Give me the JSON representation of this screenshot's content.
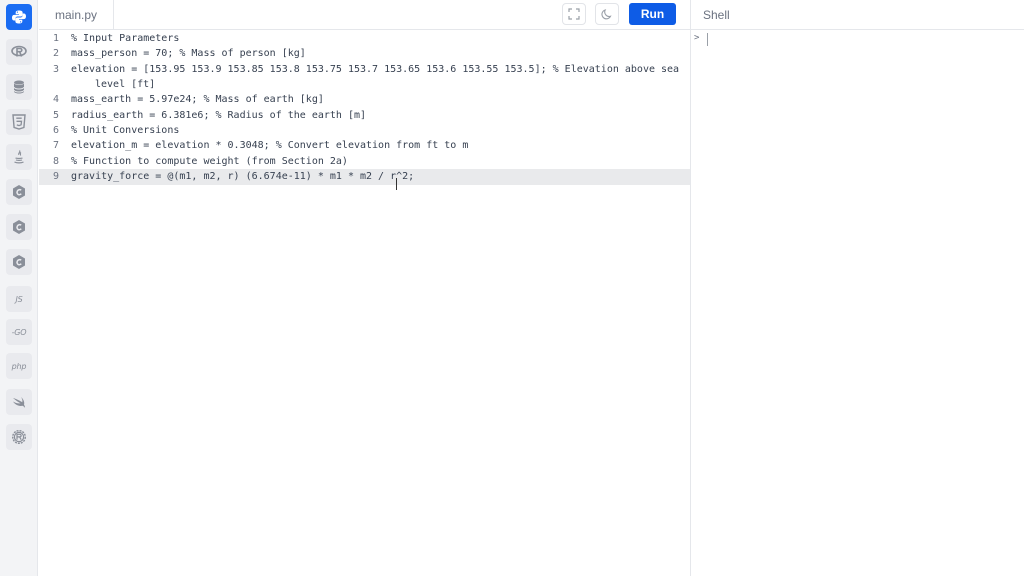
{
  "sidebar": {
    "languages": [
      {
        "name": "python",
        "icon": "python-icon",
        "active": true
      },
      {
        "name": "r",
        "icon": "r-icon",
        "active": false
      },
      {
        "name": "sql",
        "icon": "database-icon",
        "active": false
      },
      {
        "name": "html",
        "icon": "html5-icon",
        "active": false
      },
      {
        "name": "java",
        "icon": "java-icon",
        "active": false
      },
      {
        "name": "c",
        "icon": "c-icon",
        "active": false
      },
      {
        "name": "cpp",
        "icon": "cpp-icon",
        "active": false
      },
      {
        "name": "csharp",
        "icon": "csharp-icon",
        "active": false
      },
      {
        "name": "javascript",
        "label": "JS",
        "icon": "js-icon",
        "active": false
      },
      {
        "name": "go",
        "label": "-GO",
        "icon": "go-icon",
        "active": false
      },
      {
        "name": "php",
        "label": "php",
        "icon": "php-icon",
        "active": false
      },
      {
        "name": "swift",
        "icon": "swift-icon",
        "active": false
      },
      {
        "name": "rust",
        "icon": "rust-icon",
        "active": false
      }
    ],
    "accent_color": "#1a6cf2"
  },
  "header": {
    "file_tab": "main.py",
    "run_label": "Run",
    "shell_title": "Shell",
    "run_color": "#0e5ce6"
  },
  "editor": {
    "line_numbers": [
      "1",
      "2",
      "3",
      "4",
      "5",
      "6",
      "7",
      "8",
      "9"
    ],
    "current_line": 9,
    "lines": [
      "% Input Parameters",
      "mass_person = 70; % Mass of person [kg]",
      "elevation = [153.95 153.9 153.85 153.8 153.75 153.7 153.65 153.6 153.55 153.5]; % Elevation above sea",
      "mass_earth = 5.97e24; % Mass of earth [kg]",
      "radius_earth = 6.381e6; % Radius of the earth [m]",
      "% Unit Conversions",
      "elevation_m = elevation * 0.3048; % Convert elevation from ft to m",
      "% Function to compute weight (from Section 2a)",
      "gravity_force = @(m1, m2, r) (6.674e-11) * m1 * m2 / r^2;"
    ],
    "wrap_line_3": "level [ft]"
  },
  "shell": {
    "prompt": ">"
  }
}
